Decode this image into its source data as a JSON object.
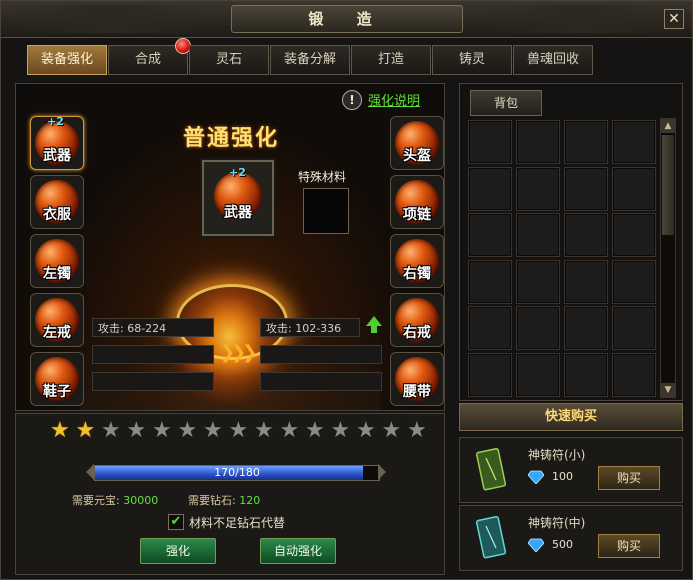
{
  "window": {
    "title": "锻 造",
    "close_label": "✕"
  },
  "tabs": [
    {
      "label": "装备强化",
      "active": true
    },
    {
      "label": "合成",
      "badge": true
    },
    {
      "label": "灵石"
    },
    {
      "label": "装备分解"
    },
    {
      "label": "打造"
    },
    {
      "label": "铸灵"
    },
    {
      "label": "兽魂回收"
    }
  ],
  "enhance": {
    "help_icon": "!",
    "help_link": "强化说明",
    "title": "普通强化",
    "left_slots": [
      {
        "label": "武器",
        "plus": "+2",
        "selected": true
      },
      {
        "label": "衣服"
      },
      {
        "label": "左镯"
      },
      {
        "label": "左戒"
      },
      {
        "label": "鞋子"
      }
    ],
    "right_slots": [
      {
        "label": "头盔"
      },
      {
        "label": "项链"
      },
      {
        "label": "右镯"
      },
      {
        "label": "右戒"
      },
      {
        "label": "腰带"
      }
    ],
    "center_item": {
      "label": "武器",
      "plus": "+2"
    },
    "special_material_label": "特殊材料",
    "stat_before": "攻击: 68-224",
    "stat_after": "攻击: 102-336",
    "arrows": "❯❯❯"
  },
  "stars": {
    "total": 15,
    "filled": 2
  },
  "progress": {
    "current": 170,
    "max": 180,
    "text": "170/180"
  },
  "costs": {
    "yuanbao_label": "需要元宝:",
    "yuanbao_value": "30000",
    "diamond_label": "需要钻石:",
    "diamond_value": "120"
  },
  "checkbox": {
    "checked": true,
    "label": "材料不足钻石代替"
  },
  "buttons": {
    "enhance": "强化",
    "auto_enhance": "自动强化"
  },
  "bag": {
    "tab_label": "背包"
  },
  "quick_buy": {
    "header": "快速购买",
    "items": [
      {
        "name": "神铸符(小)",
        "price": "100",
        "buy": "购买",
        "color": "#7ab840"
      },
      {
        "name": "神铸符(中)",
        "price": "500",
        "buy": "购买",
        "color": "#40b8b0"
      }
    ]
  },
  "colors": {
    "accent_gold": "#ffe070",
    "link_green": "#5ce038",
    "gem_blue": "#30a8ff"
  }
}
